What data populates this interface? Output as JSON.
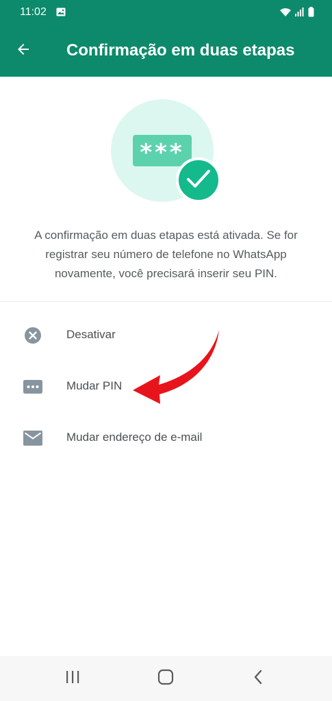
{
  "status_bar": {
    "time": "11:02",
    "left_icons": [
      "image-icon"
    ],
    "right_icons": [
      "wifi-icon",
      "signal-icon",
      "battery-icon"
    ]
  },
  "app_bar": {
    "title": "Confirmação em duas etapas",
    "back_icon": "arrow-left-icon",
    "background": "#0d8a6b"
  },
  "hero": {
    "pin_text": "***",
    "icon": "check-icon",
    "circle_color": "#dcf7ef",
    "pin_box_color": "#5cd2ac",
    "check_color": "#14b98c"
  },
  "description": "A confirmação em duas etapas está ativada. Se for registrar seu número de telefone no WhatsApp novamente, você precisará inserir seu PIN.",
  "options": [
    {
      "label": "Desativar",
      "icon": "close-circle-icon"
    },
    {
      "label": "Mudar PIN",
      "icon": "pin-dots-icon"
    },
    {
      "label": "Mudar endereço de e-mail",
      "icon": "email-icon"
    }
  ],
  "annotation": {
    "icon": "red-arrow-icon",
    "color": "#e8141c"
  },
  "nav_bar": {
    "buttons": [
      "recent-apps-icon",
      "home-icon",
      "back-chevron-icon"
    ]
  }
}
